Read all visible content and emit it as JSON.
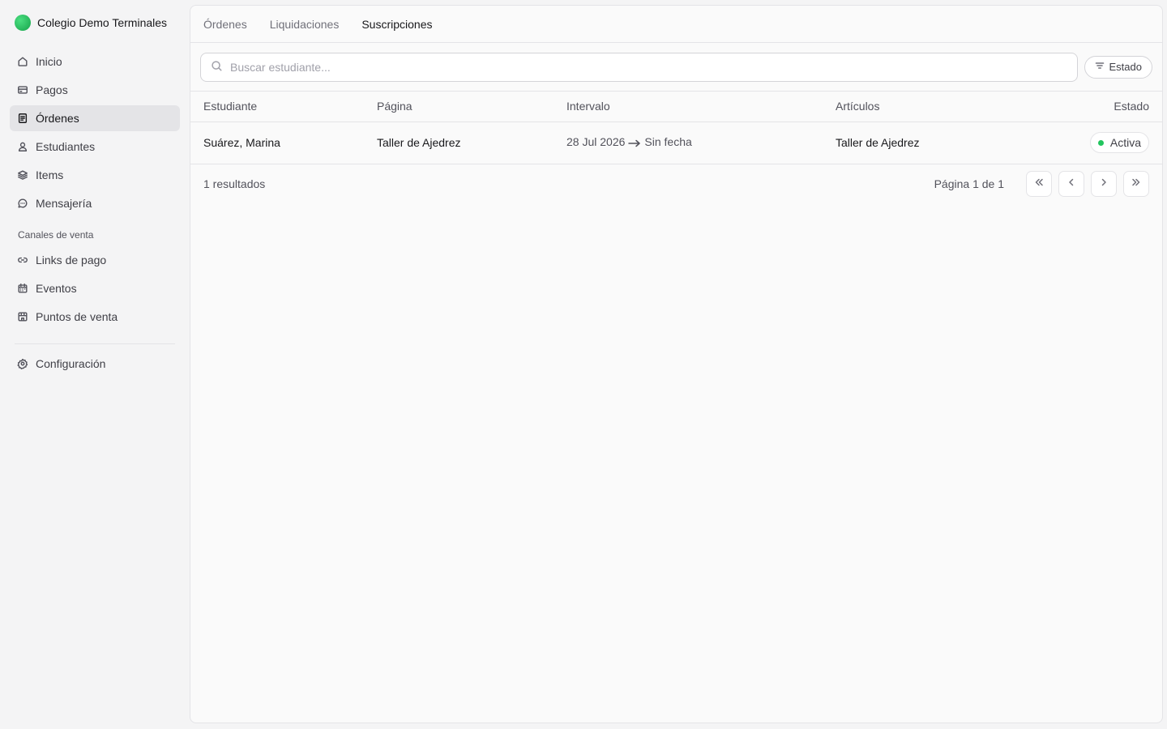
{
  "org": {
    "name": "Colegio Demo Terminales"
  },
  "sidebar": {
    "items": [
      {
        "label": "Inicio",
        "icon": "home-icon",
        "active": false
      },
      {
        "label": "Pagos",
        "icon": "credit-card-icon",
        "active": false
      },
      {
        "label": "Órdenes",
        "icon": "document-icon",
        "active": true
      },
      {
        "label": "Estudiantes",
        "icon": "user-icon",
        "active": false
      },
      {
        "label": "Items",
        "icon": "layers-icon",
        "active": false
      },
      {
        "label": "Mensajería",
        "icon": "message-icon",
        "active": false
      }
    ],
    "section_label": "Canales de venta",
    "channel_items": [
      {
        "label": "Links de pago",
        "icon": "link-icon"
      },
      {
        "label": "Eventos",
        "icon": "calendar-icon"
      },
      {
        "label": "Puntos de venta",
        "icon": "store-icon"
      }
    ],
    "settings_label": "Configuración"
  },
  "tabs": [
    {
      "label": "Órdenes",
      "active": false
    },
    {
      "label": "Liquidaciones",
      "active": false
    },
    {
      "label": "Suscripciones",
      "active": true
    }
  ],
  "search": {
    "placeholder": "Buscar estudiante...",
    "value": ""
  },
  "filter": {
    "label": "Estado"
  },
  "table": {
    "columns": [
      "Estudiante",
      "Página",
      "Intervalo",
      "Artículos",
      "Estado"
    ],
    "rows": [
      {
        "student": "Suárez, Marina",
        "page": "Taller de Ajedrez",
        "interval_start": "28 Jul 2026",
        "interval_end": "Sin fecha",
        "items": "Taller de Ajedrez",
        "status": "Activa"
      }
    ]
  },
  "footer": {
    "results": "1 resultados",
    "page_info": "Página 1 de 1"
  },
  "colors": {
    "status_active": "#22c55e",
    "brand": "#22c55e"
  }
}
